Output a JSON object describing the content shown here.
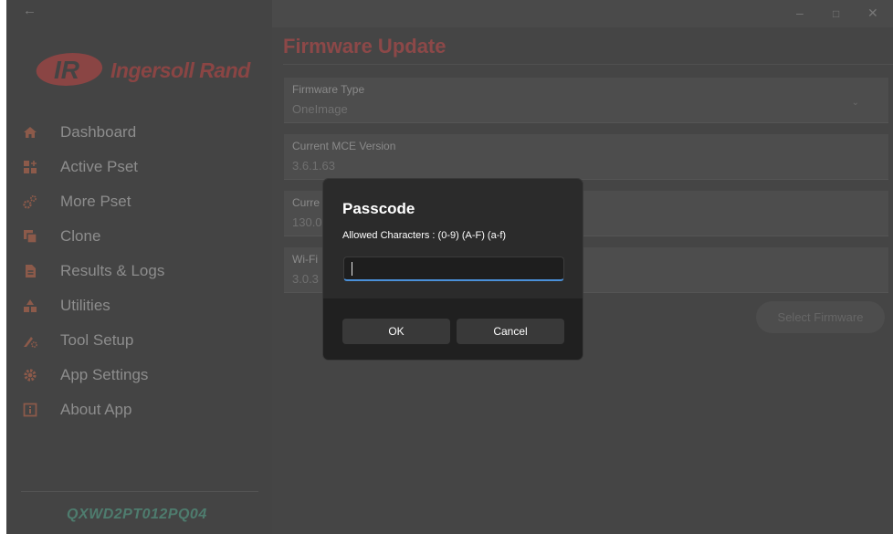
{
  "app": {
    "brand": "Ingersoll Rand",
    "device_id": "QXWD2PT012PQ04",
    "back_glyph": "←",
    "window_controls": [
      "–",
      "□",
      "✕"
    ]
  },
  "sidebar": {
    "items": [
      {
        "label": "Dashboard",
        "icon": "home-icon"
      },
      {
        "label": "Active Pset",
        "icon": "pset-grid-icon"
      },
      {
        "label": "More Pset",
        "icon": "gears-icon"
      },
      {
        "label": "Clone",
        "icon": "clone-icon"
      },
      {
        "label": "Results & Logs",
        "icon": "document-icon"
      },
      {
        "label": "Utilities",
        "icon": "shapes-icon"
      },
      {
        "label": "Tool Setup",
        "icon": "tool-gear-icon"
      },
      {
        "label": "App Settings",
        "icon": "gear-icon"
      },
      {
        "label": "About App",
        "icon": "info-icon"
      }
    ]
  },
  "main": {
    "title": "Firmware Update",
    "fields": [
      {
        "label": "Firmware Type",
        "value": "OneImage",
        "dropdown": true
      },
      {
        "label": "Current MCE Version",
        "value": "3.6.1.63"
      },
      {
        "label": "Curre",
        "value": "130.0"
      },
      {
        "label": "Wi-Fi",
        "value": "3.0.3"
      }
    ],
    "select_firmware": "Select Firmware"
  },
  "dialog": {
    "title": "Passcode",
    "subtitle": "Allowed Characters : (0-9) (A-F) (a-f)",
    "input_value": "",
    "ok": "OK",
    "cancel": "Cancel"
  },
  "colors": {
    "accent": "#8c4848",
    "device_id": "#4e7c6e",
    "input_focus": "#4a90d9",
    "icon_orange": "#8c5a4a"
  }
}
